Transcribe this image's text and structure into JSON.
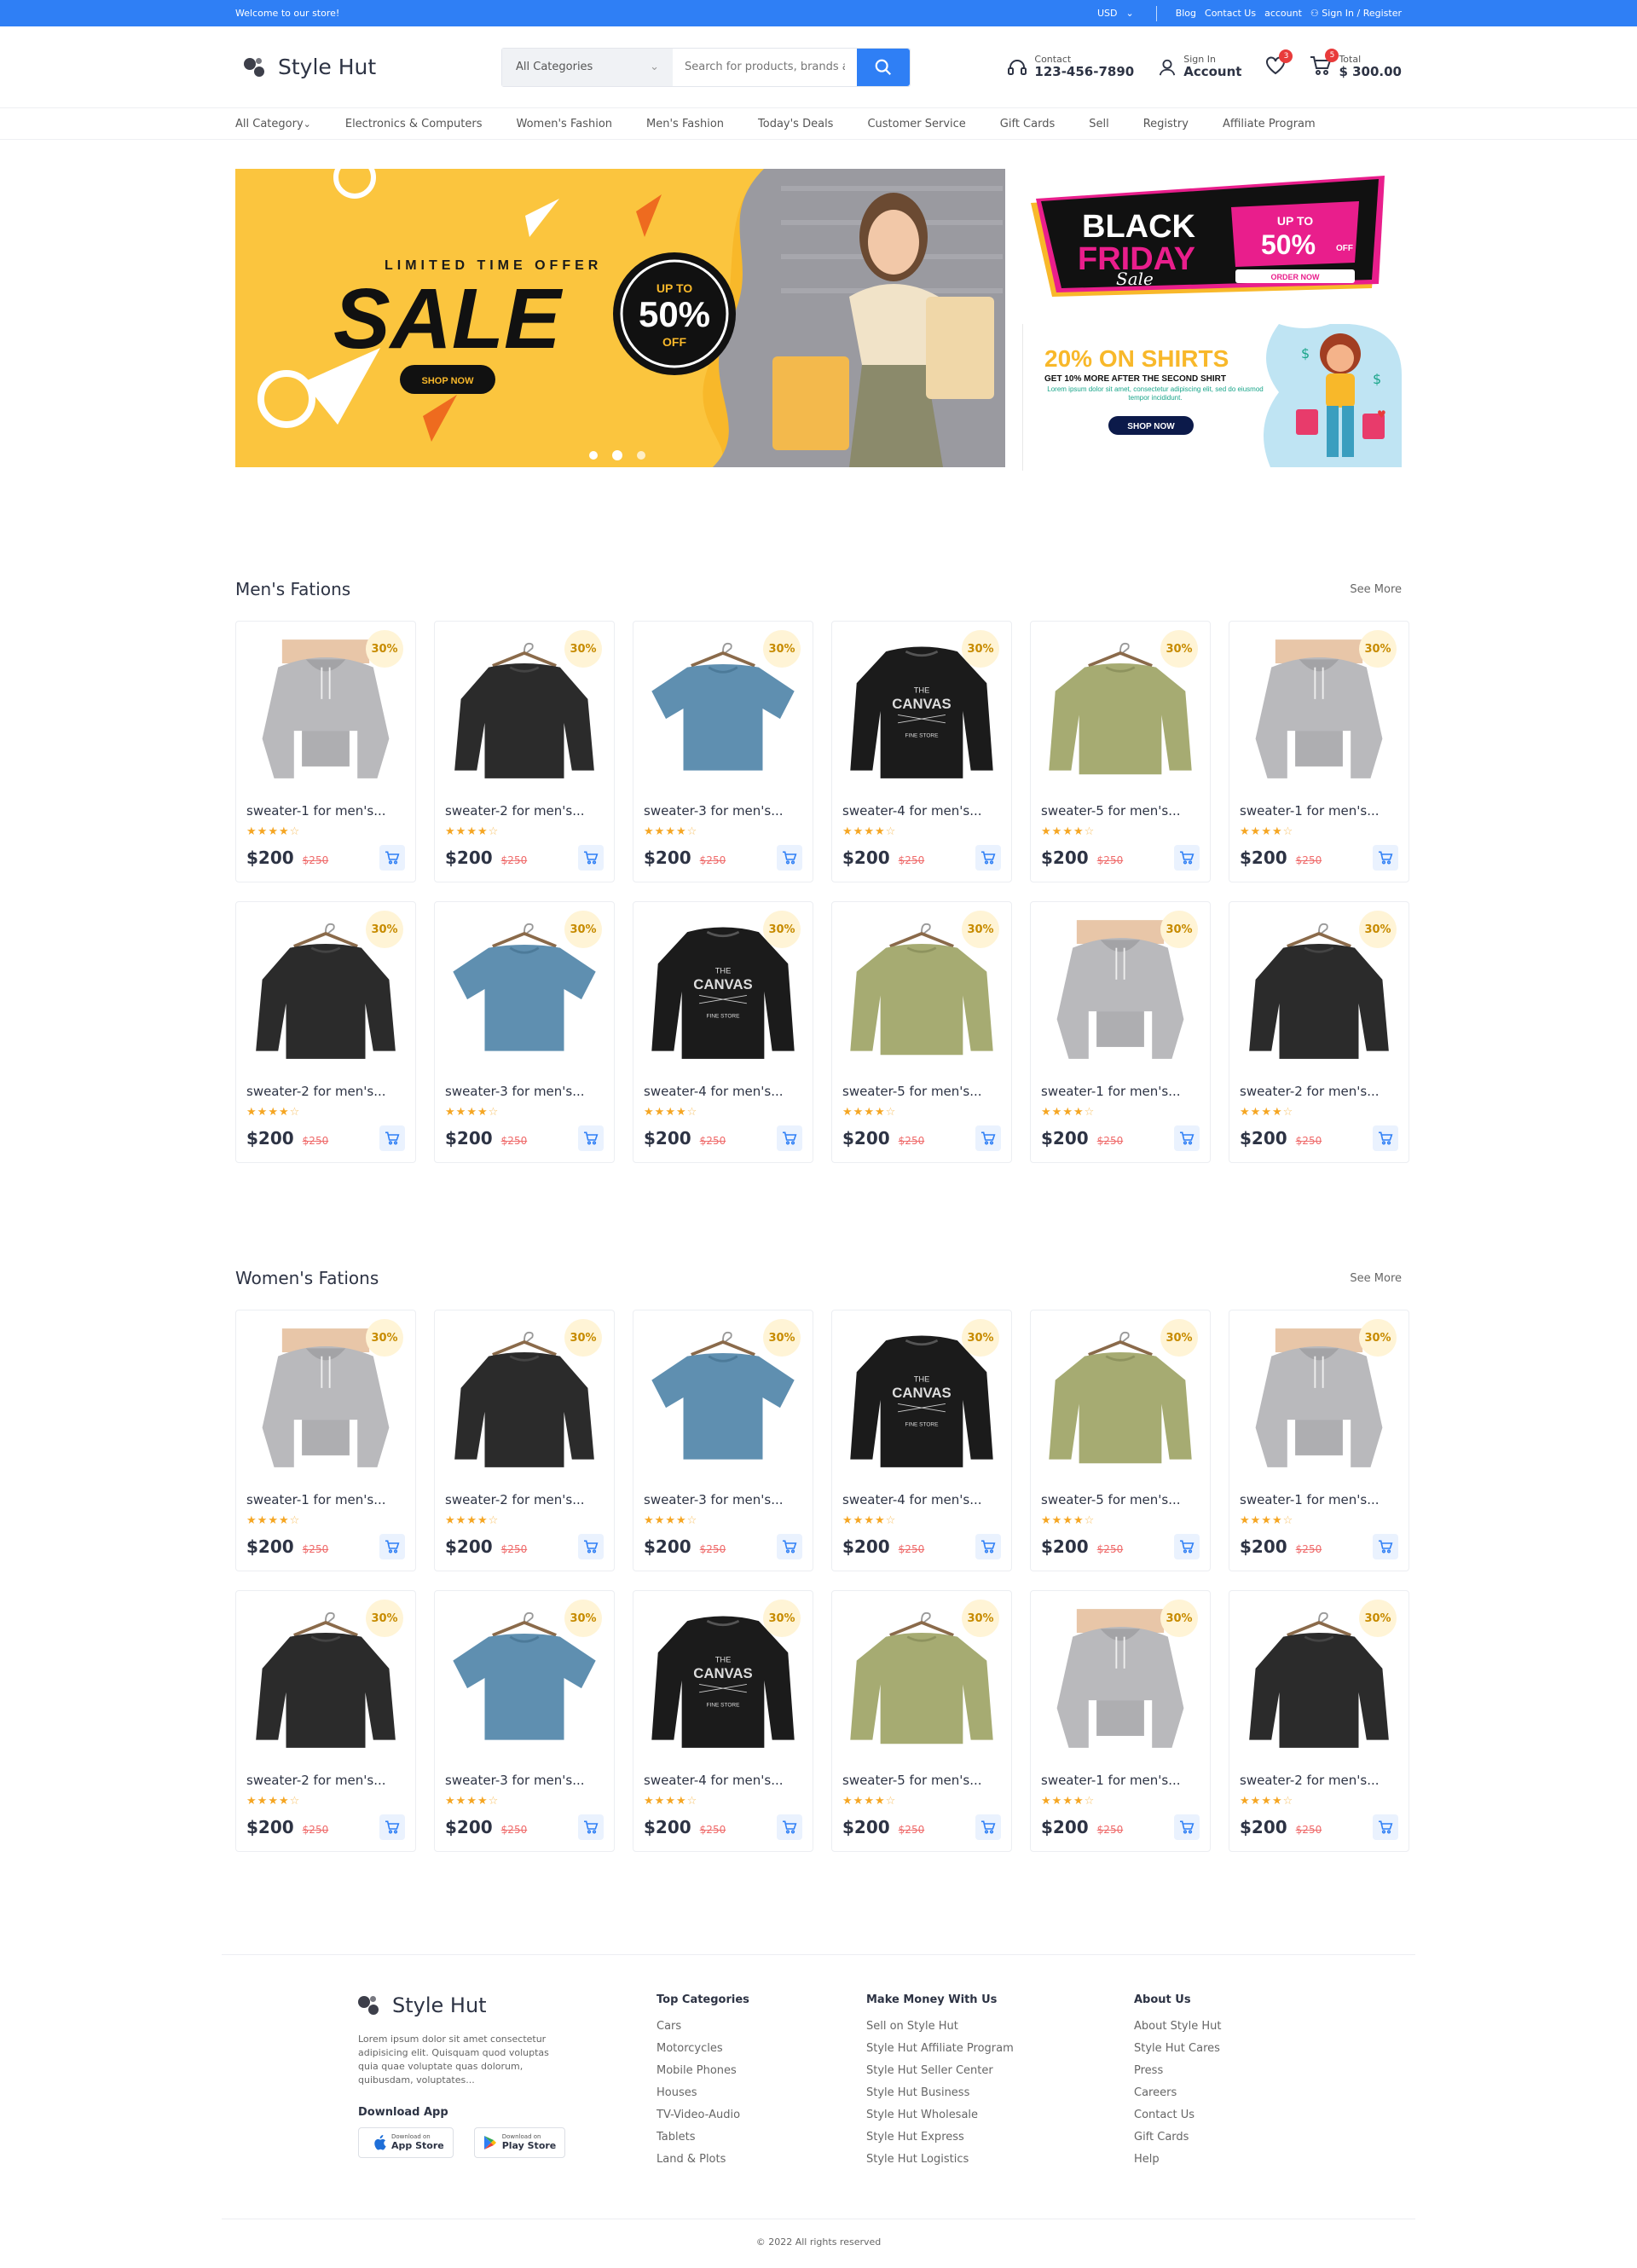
{
  "topbar": {
    "welcome": "Welcome to our store!",
    "currency": "USD",
    "blog": "Blog",
    "contact": "Contact Us",
    "account": "account",
    "signin": "Sign In / Register"
  },
  "header": {
    "logo": "Style Hut",
    "search_category": "All Categories",
    "search_placeholder": "Search for products, brands and more",
    "contact_label": "Contact",
    "contact_number": "123-456-7890",
    "signin_label": "Sign In",
    "account_label": "Account",
    "wishlist_count": "3",
    "cart_count": "5",
    "total_label": "Total",
    "total_value": "$ 300.00"
  },
  "nav": [
    "All Category",
    "Electronics & Computers",
    "Women's Fashion",
    "Men's Fashion",
    "Today's Deals",
    "Customer Service",
    "Gift Cards",
    "Sell",
    "Registry",
    "Affiliate Program"
  ],
  "banner": {
    "limited": "LIMITED TIME OFFER",
    "sale": "SALE",
    "up_to": "UP TO",
    "percent": "50%",
    "off": "OFF",
    "shop_now": "SHOP NOW",
    "bf_black": "BLACK",
    "bf_friday": "FRIDAY",
    "bf_sale": "Sale",
    "bf_upto": "UP TO",
    "bf_percent": "50%",
    "bf_off": "OFF",
    "bf_order": "ORDER NOW",
    "shirts_title": "20% ON SHIRTS",
    "shirts_sub": "GET 10% MORE AFTER THE SECOND SHIRT",
    "shirts_text": "Lorem ipsum dolor sit amet, consectetur adipiscing elit, sed do eiusmod tempor incididunt.",
    "shirts_btn": "SHOP NOW"
  },
  "sections": [
    {
      "title": "Men's Fations",
      "see_more": "See More"
    },
    {
      "title": "Women's Fations",
      "see_more": "See More"
    }
  ],
  "products": [
    {
      "name": "sweater-1 for men's...",
      "discount": "30%",
      "price": "$200",
      "old_price": "$250",
      "rating": 4,
      "image": "grey-hoodie"
    },
    {
      "name": "sweater-2 for men's...",
      "discount": "30%",
      "price": "$200",
      "old_price": "$250",
      "rating": 4,
      "image": "black-sweater"
    },
    {
      "name": "sweater-3 for men's...",
      "discount": "30%",
      "price": "$200",
      "old_price": "$250",
      "rating": 4,
      "image": "blue-tshirt"
    },
    {
      "name": "sweater-4 for men's...",
      "discount": "30%",
      "price": "$200",
      "old_price": "$250",
      "rating": 4,
      "image": "canvas-sweater"
    },
    {
      "name": "sweater-5 for men's...",
      "discount": "30%",
      "price": "$200",
      "old_price": "$250",
      "rating": 4,
      "image": "olive-sweater"
    },
    {
      "name": "sweater-1 for men's...",
      "discount": "30%",
      "price": "$200",
      "old_price": "$250",
      "rating": 4,
      "image": "grey-hoodie"
    },
    {
      "name": "sweater-2 for men's...",
      "discount": "30%",
      "price": "$200",
      "old_price": "$250",
      "rating": 4,
      "image": "black-sweater"
    },
    {
      "name": "sweater-3 for men's...",
      "discount": "30%",
      "price": "$200",
      "old_price": "$250",
      "rating": 4,
      "image": "blue-tshirt"
    },
    {
      "name": "sweater-4 for men's...",
      "discount": "30%",
      "price": "$200",
      "old_price": "$250",
      "rating": 4,
      "image": "canvas-sweater"
    },
    {
      "name": "sweater-5 for men's...",
      "discount": "30%",
      "price": "$200",
      "old_price": "$250",
      "rating": 4,
      "image": "olive-sweater"
    },
    {
      "name": "sweater-1 for men's...",
      "discount": "30%",
      "price": "$200",
      "old_price": "$250",
      "rating": 4,
      "image": "grey-hoodie"
    },
    {
      "name": "sweater-2 for men's...",
      "discount": "30%",
      "price": "$200",
      "old_price": "$250",
      "rating": 4,
      "image": "black-sweater"
    }
  ],
  "footer": {
    "logo": "Style Hut",
    "about": "Lorem ipsum dolor sit amet consectetur adipisicing elit. Quisquam quod voluptas quia quae voluptate quas dolorum, quibusdam, voluptates...",
    "download": "Download App",
    "appstore_small": "Download on",
    "appstore": "App Store",
    "playstore_small": "Download on",
    "playstore": "Play Store",
    "columns": [
      {
        "title": "Top Categories",
        "links": [
          "Cars",
          "Motorcycles",
          "Mobile Phones",
          "Houses",
          "TV-Video-Audio",
          "Tablets",
          "Land & Plots"
        ]
      },
      {
        "title": "Make Money With Us",
        "links": [
          "Sell on Style Hut",
          "Style Hut Affiliate Program",
          "Style Hut Seller Center",
          "Style Hut Business",
          "Style Hut Wholesale",
          "Style Hut Express",
          "Style Hut Logistics"
        ]
      },
      {
        "title": "About Us",
        "links": [
          "About Style Hut",
          "Style Hut Cares",
          "Press",
          "Careers",
          "Contact Us",
          "Gift Cards",
          "Help"
        ]
      }
    ],
    "copyright": "© 2022 All rights reserved"
  },
  "colors": {
    "accent": "#2f7ff5",
    "sale_yellow": "#f8b82a",
    "price_old": "#ef6b6b",
    "star": "#f5a623"
  }
}
